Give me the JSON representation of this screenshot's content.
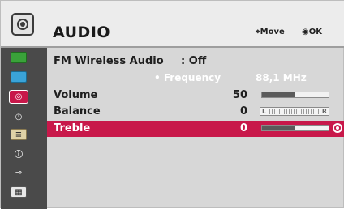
{
  "header": {
    "title": "AUDIO",
    "hint_move": "Move",
    "hint_ok": "OK"
  },
  "sidebar": {
    "items": [
      {
        "name": "picture",
        "color": "#3aa23a"
      },
      {
        "name": "screen",
        "color": "#3aa3d8"
      },
      {
        "name": "audio",
        "color": "#c8184a"
      },
      {
        "name": "time",
        "color": "#e0e0e0"
      },
      {
        "name": "setup",
        "color": "#e0d2a6"
      },
      {
        "name": "option",
        "color": "#8a2a8a"
      },
      {
        "name": "input",
        "color": "#d8d8d8"
      },
      {
        "name": "movie",
        "color": "#d8d8d8"
      }
    ]
  },
  "rows": [
    {
      "label": "FM Wireless Audio",
      "value": ": Off"
    },
    {
      "label": "• Frequency",
      "value": "88,1 MHz"
    },
    {
      "label": "Volume",
      "value": "50",
      "level": 0.5
    },
    {
      "label": "Balance",
      "value": "0",
      "bar_left": "L",
      "bar_right": "R"
    },
    {
      "label": "Treble",
      "value": "0",
      "level": 0.5
    }
  ]
}
